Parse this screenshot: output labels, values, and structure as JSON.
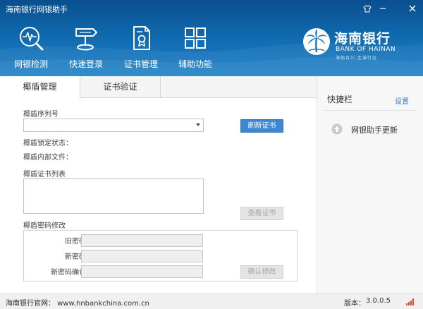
{
  "window": {
    "title": "海南银行网银助手"
  },
  "nav": {
    "items": [
      {
        "label": "网银检测",
        "icon": "magnifier-pulse-icon"
      },
      {
        "label": "快速登录",
        "icon": "signpost-icon"
      },
      {
        "label": "证书管理",
        "icon": "certificate-icon"
      },
      {
        "label": "辅助功能",
        "icon": "grid-icon"
      }
    ]
  },
  "brand": {
    "name_cn": "海南银行",
    "name_en": "BANK OF HAINAN",
    "slogan": "海纳百川 至诚行远",
    "logo_icon": "palm-tree-logo-icon"
  },
  "tabs": [
    {
      "label": "椰盾管理",
      "active": true
    },
    {
      "label": "证书验证",
      "active": false
    }
  ],
  "ukey": {
    "serial_label": "椰盾序列号",
    "serial_value": "",
    "refresh_button": "刷新证书",
    "lock_status_label": "椰盾锁定状态：",
    "lock_status_value": "",
    "internal_files_label": "椰盾内部文件：",
    "internal_files_value": "",
    "cert_list_label": "椰盾证书列表",
    "view_cert_button": "查看证书",
    "pwd_section_label": "椰盾密码修改",
    "old_pwd_label": "旧密码：",
    "new_pwd_label": "新密码：",
    "confirm_pwd_label": "新密码确认：",
    "confirm_button": "确认修改"
  },
  "sidebar": {
    "title": "快捷栏",
    "settings": "设置",
    "items": [
      {
        "label": "网银助手更新",
        "icon": "upload-arrow-icon"
      }
    ]
  },
  "footer": {
    "site": "海南银行官网： www.hnbankchina.com.cn",
    "version_label": "版本：",
    "version": "3.0.0.5",
    "signal_icon": "signal-bars-icon"
  },
  "colors": {
    "header_top": "#0a4f8e",
    "header_bottom": "#1c7fc4",
    "primary_button": "#3d87d2",
    "link": "#2f7bc9",
    "signal": "#e8471f"
  }
}
